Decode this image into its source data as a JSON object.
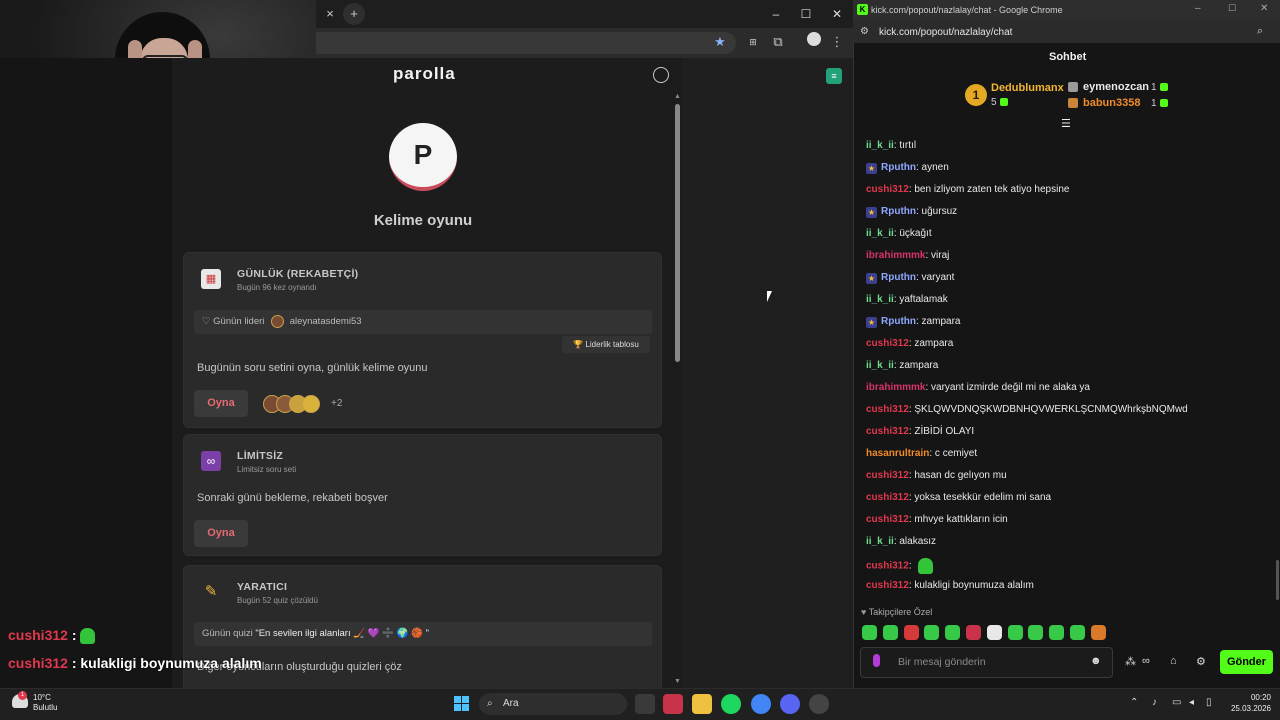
{
  "browser_left": {
    "url": "",
    "window_controls": {
      "minimize": "–",
      "maximize": "☐",
      "close": "✕"
    },
    "tab_close": "×",
    "new_tab": "+"
  },
  "site": {
    "brand": "parolla",
    "avatar_letter": "P",
    "game_title": "Kelime oyunu",
    "cards": [
      {
        "icon": "calendar-icon",
        "title": "GÜNLÜK (REKABETÇİ)",
        "subtitle": "Bugün 96 kez oynandı",
        "leader_label": "Günün lideri",
        "leader_name": "aleynatasdemi53",
        "leaderboard_button": "🏆 Liderlik tablosu",
        "description": "Bugünün soru setini oyna, günlük kelime oyunu",
        "play_label": "Oyna",
        "extra_players": "+2"
      },
      {
        "icon": "infinity-icon",
        "title": "LİMİTSİZ",
        "subtitle": "Limitsiz soru seti",
        "description": "Sonraki günü bekleme, rekabeti boşver",
        "play_label": "Oyna"
      },
      {
        "icon": "pencil-icon",
        "title": "YARATICI",
        "subtitle": "Bugün 52 quiz çözüldü",
        "quiz_label": "Günün quizi",
        "quiz_title": "\"En sevilen ilgi alanları 🏒 💜 ➗ 🌍 🏀 \"",
        "description": "Diğer oyuncuların oluşturduğu quizleri çöz"
      }
    ]
  },
  "stream_overlay": [
    {
      "user": "cushi312",
      "sep": " : ",
      "text": ""
    },
    {
      "user": "cushi312",
      "sep": " : ",
      "text": "kulakligi boynumuza alalım"
    }
  ],
  "chat_window": {
    "title": "kick.com/popout/nazlalay/chat - Google Chrome",
    "url": "kick.com/popout/nazlalay/chat",
    "header": "Sohbet",
    "top": [
      {
        "rank": "1",
        "name": "Dedublumanx",
        "count": "5"
      },
      {
        "name": "eymenozcan",
        "count": "1"
      },
      {
        "name": "babun3358",
        "count": "1"
      }
    ],
    "messages": [
      {
        "user": "ii_k_ii",
        "color": "#6fdc8c",
        "text": ": tırtıl",
        "badge": false
      },
      {
        "user": "Rputhn",
        "color": "#8ea8ff",
        "text": ": aynen",
        "badge": true
      },
      {
        "user": "cushi312",
        "color": "#e0384c",
        "text": ": ben izliyom zaten tek atiyo hepsine",
        "badge": false
      },
      {
        "user": "Rputhn",
        "color": "#8ea8ff",
        "text": ": uğursuz",
        "badge": true
      },
      {
        "user": "ii_k_ii",
        "color": "#6fdc8c",
        "text": ": üçkağıt",
        "badge": false
      },
      {
        "user": "ibrahimmmk",
        "color": "#d6336c",
        "text": ": viraj",
        "badge": false
      },
      {
        "user": "Rputhn",
        "color": "#8ea8ff",
        "text": ": varyant",
        "badge": true
      },
      {
        "user": "ii_k_ii",
        "color": "#6fdc8c",
        "text": ": yaftalamak",
        "badge": false
      },
      {
        "user": "Rputhn",
        "color": "#8ea8ff",
        "text": ": zampara",
        "badge": true
      },
      {
        "user": "cushi312",
        "color": "#e0384c",
        "text": ": zampara",
        "badge": false
      },
      {
        "user": "ii_k_ii",
        "color": "#6fdc8c",
        "text": ": zampara",
        "badge": false
      },
      {
        "user": "ibrahimmmk",
        "color": "#d6336c",
        "text": ": varyant izmirde değil mi ne alaka ya",
        "badge": false
      },
      {
        "user": "cushi312",
        "color": "#e0384c",
        "text": ": ŞKLQWVDNQŞKWDBNHQVWERKLŞCNMQWhrkşbNQMwd",
        "badge": false
      },
      {
        "user": "cushi312",
        "color": "#e0384c",
        "text": ": ZİBİDİ OLAYI",
        "badge": false
      },
      {
        "user": "hasanrultrain",
        "color": "#f08c2a",
        "text": ": c cemiyet",
        "badge": false
      },
      {
        "user": "cushi312",
        "color": "#e0384c",
        "text": ": hasan dc gelıyon mu",
        "badge": false
      },
      {
        "user": "cushi312",
        "color": "#e0384c",
        "text": ": yoksa tesekkür edelim mi sana",
        "badge": false
      },
      {
        "user": "cushi312",
        "color": "#e0384c",
        "text": ": mhvye kattıkların icin",
        "badge": false
      },
      {
        "user": "ii_k_ii",
        "color": "#6fdc8c",
        "text": ": alakasız",
        "badge": false
      },
      {
        "user": "cushi312",
        "color": "#e0384c",
        "text": ": ",
        "badge": false
      },
      {
        "user": "cushi312",
        "color": "#e0384c",
        "text": ": kulakligi boynumuza alalım",
        "badge": false
      }
    ],
    "emote_section": "Takipçilere Özel",
    "input_placeholder": "Bir mesaj gönderin",
    "send_label": "Gönder"
  },
  "taskbar": {
    "temp": "10°C",
    "weather": "Bulutlu",
    "search": "Ara",
    "time": "00:20",
    "date": "25.03.2026"
  },
  "colors": {
    "kick_green": "#53fc18",
    "accent_red": "#e46a73"
  }
}
